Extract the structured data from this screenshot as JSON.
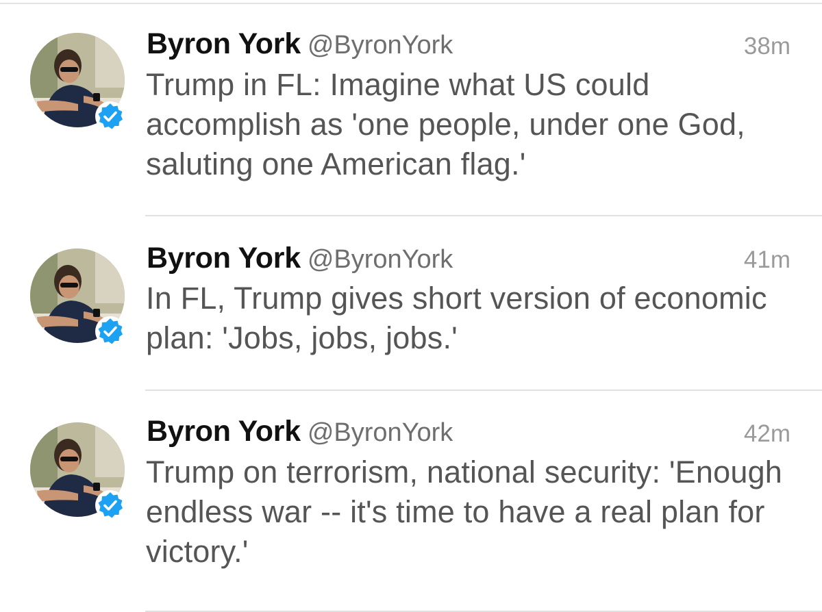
{
  "tweets": [
    {
      "name": "Byron York",
      "handle": "@ByronYork",
      "time": "38m",
      "text": "Trump in FL: Imagine what US could accomplish as 'one people, under one God, saluting one American flag.'"
    },
    {
      "name": "Byron York",
      "handle": "@ByronYork",
      "time": "41m",
      "text": "In FL, Trump gives short version of economic plan: 'Jobs, jobs, jobs.'"
    },
    {
      "name": "Byron York",
      "handle": "@ByronYork",
      "time": "42m",
      "text": "Trump on terrorism, national security: 'Enough endless war -- it's time to have a real plan for victory.'"
    }
  ],
  "colors": {
    "verified_blue": "#1da1f2",
    "name_text": "#111111",
    "handle_text": "#6e6e6e",
    "time_text": "#9a9a9a",
    "body_text": "#555555"
  },
  "icons": {
    "verified": "verified-badge-icon",
    "avatar": "profile-photo"
  }
}
